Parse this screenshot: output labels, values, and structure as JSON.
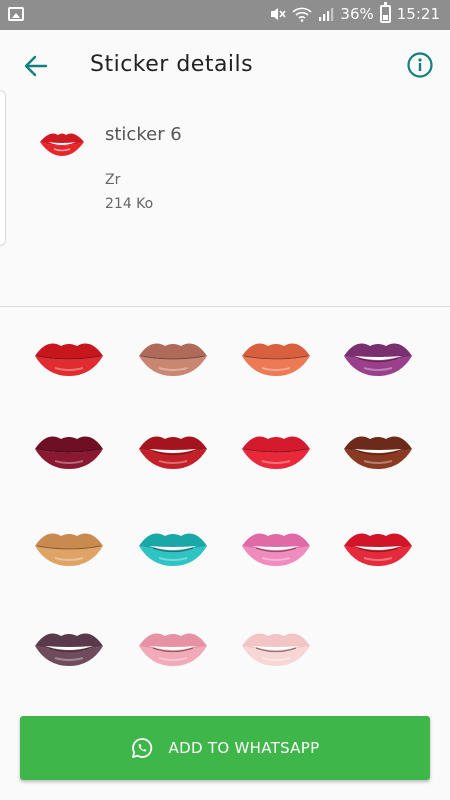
{
  "status_bar": {
    "battery": "36%",
    "time": "15:21",
    "icons": [
      "gallery-icon",
      "mute-icon",
      "wifi-icon",
      "signal-icon",
      "battery-icon"
    ]
  },
  "app_bar": {
    "title": "Sticker details",
    "back_icon": "arrow-left-icon",
    "info_icon": "info-icon"
  },
  "pack": {
    "name": "sticker 6",
    "author": "Zr",
    "size": "214 Ko"
  },
  "stickers": [
    {
      "name": "red-lips",
      "upper": "#c8161d",
      "lower": "#e02c30",
      "teeth": false
    },
    {
      "name": "kiss-nude-lips",
      "upper": "#b06a5a",
      "lower": "#c98671",
      "teeth": false
    },
    {
      "name": "orange-lips",
      "upper": "#d8603e",
      "lower": "#ec7a55",
      "teeth": false
    },
    {
      "name": "purple-lips-teeth",
      "upper": "#7a2f6e",
      "lower": "#9a3f8c",
      "teeth": true
    },
    {
      "name": "burgundy-lips",
      "upper": "#6e0f24",
      "lower": "#8a1830",
      "teeth": false
    },
    {
      "name": "red-lips-teeth",
      "upper": "#a3141f",
      "lower": "#c42029",
      "teeth": true
    },
    {
      "name": "kiss-red-lips",
      "upper": "#d41a2c",
      "lower": "#e9283a",
      "teeth": false
    },
    {
      "name": "brown-lips-teeth",
      "upper": "#6b2a1a",
      "lower": "#8a3a22",
      "teeth": true
    },
    {
      "name": "tan-lips",
      "upper": "#c88a4e",
      "lower": "#dfa365",
      "teeth": false
    },
    {
      "name": "turquoise-lips-bite",
      "upper": "#1aa7a8",
      "lower": "#2ec4c4",
      "teeth": true
    },
    {
      "name": "pink-lips-tongue",
      "upper": "#e06aa6",
      "lower": "#f08cbd",
      "teeth": true
    },
    {
      "name": "red-lips-tongue",
      "upper": "#d21428",
      "lower": "#e52a3c",
      "teeth": true
    },
    {
      "name": "plum-lips-teeth",
      "upper": "#5a3a4a",
      "lower": "#6f4c5c",
      "teeth": true
    },
    {
      "name": "light-pink-lips-teeth",
      "upper": "#e792a4",
      "lower": "#f2aab8",
      "teeth": true
    },
    {
      "name": "pale-pink-lips-teeth",
      "upper": "#f2c4c4",
      "lower": "#f7d6d6",
      "teeth": true
    }
  ],
  "add_button": {
    "label": "ADD TO WHATSAPP",
    "icon": "whatsapp-icon",
    "color": "#3fb649"
  }
}
